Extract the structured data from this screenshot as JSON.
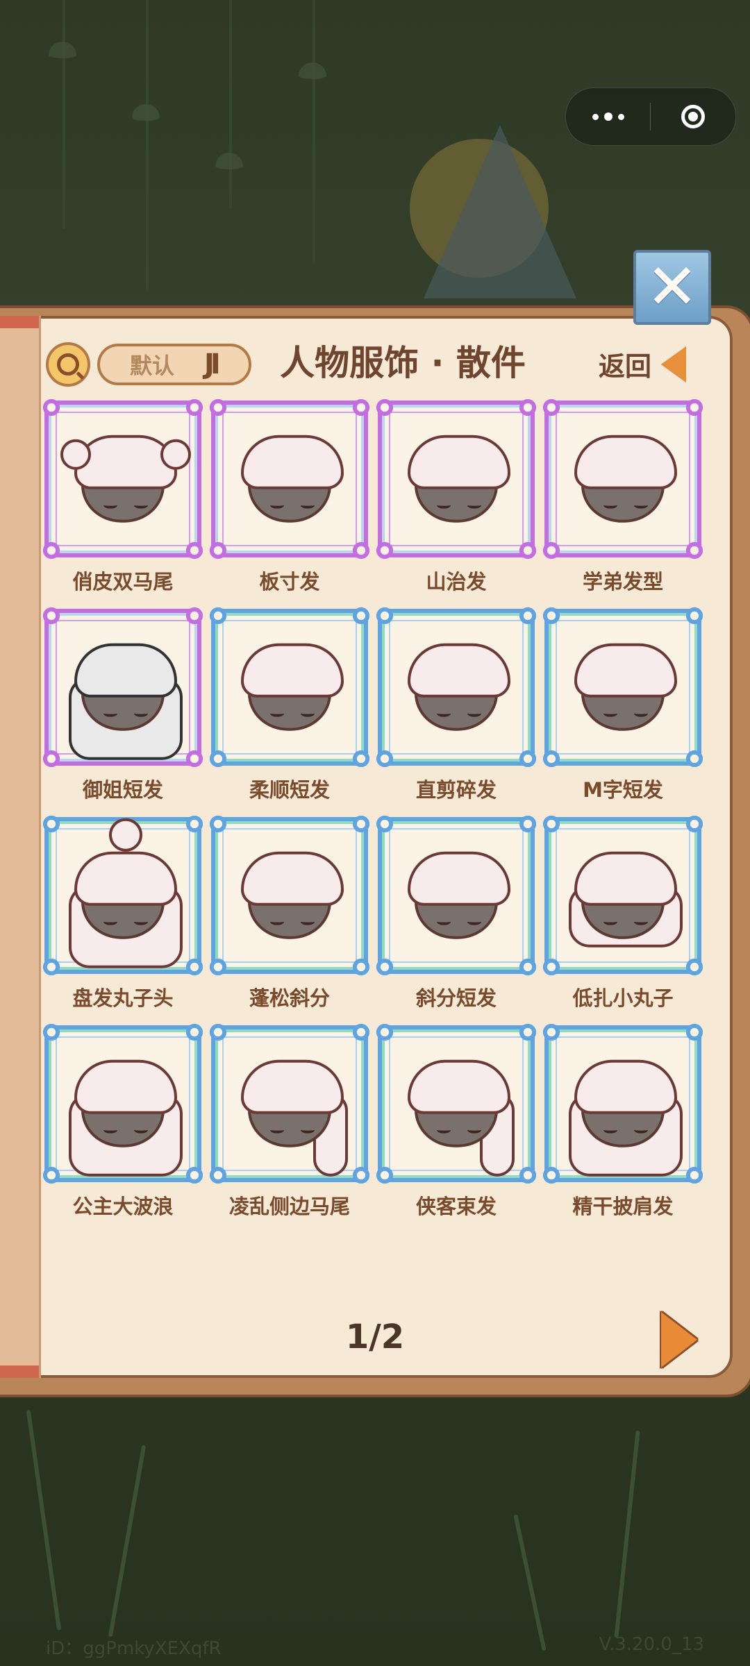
{
  "header": {
    "sort_label": "默认",
    "sort_icon": "JI",
    "title": "人物服饰 · 散件",
    "back_label": "返回"
  },
  "items": [
    {
      "label": "俏皮双马尾",
      "rarity": "purple"
    },
    {
      "label": "板寸发",
      "rarity": "purple"
    },
    {
      "label": "山治发",
      "rarity": "purple"
    },
    {
      "label": "学弟发型",
      "rarity": "purple"
    },
    {
      "label": "御姐短发",
      "rarity": "purple"
    },
    {
      "label": "柔顺短发",
      "rarity": "blue"
    },
    {
      "label": "直剪碎发",
      "rarity": "blue"
    },
    {
      "label": "M字短发",
      "rarity": "blue"
    },
    {
      "label": "盘发丸子头",
      "rarity": "blue"
    },
    {
      "label": "蓬松斜分",
      "rarity": "blue"
    },
    {
      "label": "斜分短发",
      "rarity": "blue"
    },
    {
      "label": "低扎小丸子",
      "rarity": "blue"
    },
    {
      "label": "公主大波浪",
      "rarity": "blue"
    },
    {
      "label": "凌乱侧边马尾",
      "rarity": "blue"
    },
    {
      "label": "侠客束发",
      "rarity": "blue"
    },
    {
      "label": "精干披肩发",
      "rarity": "blue"
    }
  ],
  "pagination": {
    "indicator": "1/2"
  },
  "footer": {
    "id": "iD：ggPmkyXEXqfR",
    "version": "V.3.20.0_13"
  },
  "colors": {
    "purple_frame": "#c26de0",
    "blue_frame": "#5fa3e0",
    "accent_orange": "#e88a36"
  }
}
